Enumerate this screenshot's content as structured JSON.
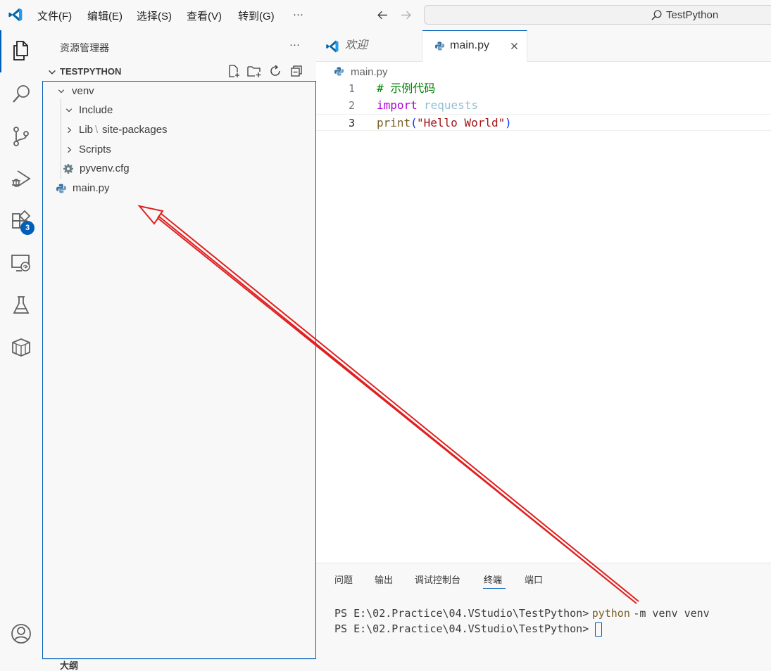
{
  "menu": [
    "文件(F)",
    "编辑(E)",
    "选择(S)",
    "查看(V)",
    "转到(G)",
    "···"
  ],
  "search": {
    "text": "TestPython"
  },
  "activity": {
    "extensions_badge": "3"
  },
  "sidebar": {
    "title": "资源管理器",
    "more": "···",
    "folder": "TESTPYTHON",
    "tree": {
      "venv": "venv",
      "include": "Include",
      "lib": "Lib",
      "lib_sep": "\\",
      "site_packages": "site-packages",
      "scripts": "Scripts",
      "pyvenv": "pyvenv.cfg",
      "main": "main.py"
    },
    "bottom_section": "大纲"
  },
  "editor": {
    "tabs": [
      {
        "label": "欢迎"
      },
      {
        "label": "main.py"
      }
    ],
    "breadcrumb": "main.py",
    "line_numbers": [
      "1",
      "2",
      "3"
    ],
    "code": {
      "l1_comment": "# 示例代码",
      "l2_keyword": "import",
      "l2_module": "requests",
      "l3_fn": "print",
      "l3_open": "(",
      "l3_string": "\"Hello World\"",
      "l3_close": ")"
    }
  },
  "panel": {
    "tabs": [
      "问题",
      "输出",
      "调试控制台",
      "终端",
      "端口"
    ],
    "active_tab": "终端",
    "terminal": {
      "prompt": "PS E:\\02.Practice\\04.VStudio\\TestPython>",
      "cmd": "python",
      "args": "-m venv venv"
    }
  },
  "colors": {
    "accent": "#005fb8",
    "annotation_arrow": "#e02020",
    "comment": "#008000",
    "keyword": "#af00db",
    "string": "#a31515",
    "function": "#795e26"
  }
}
